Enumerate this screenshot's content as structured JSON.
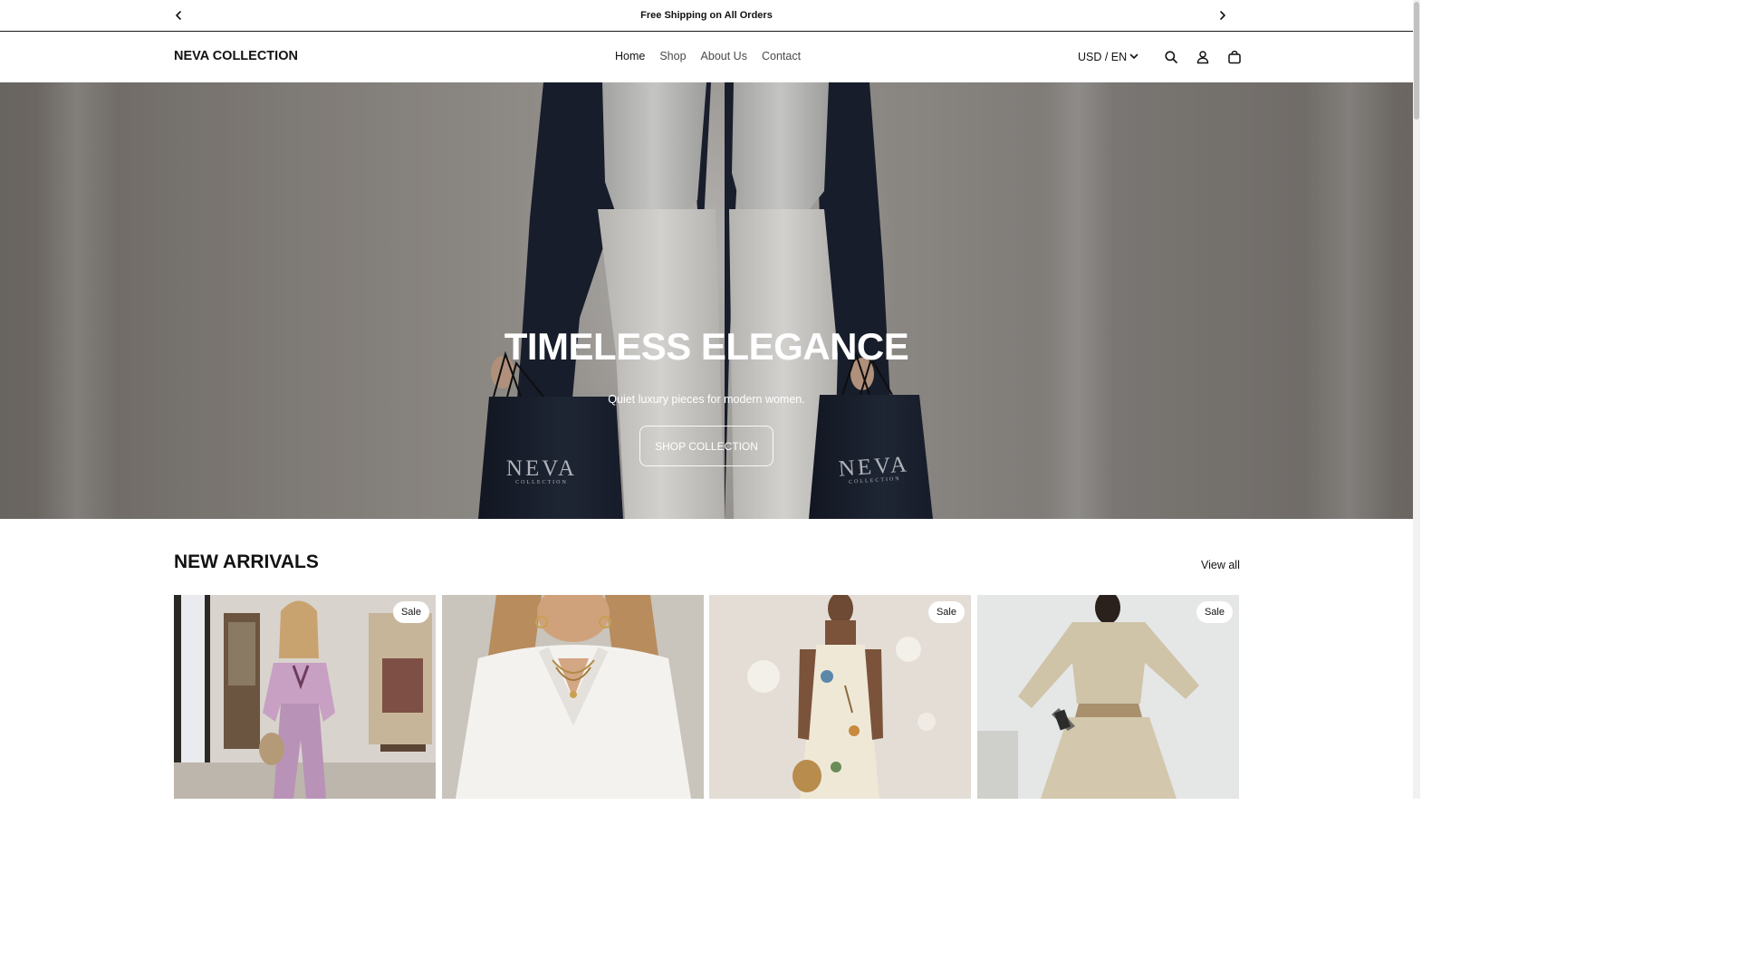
{
  "announcement": {
    "text": "Free Shipping on All Orders",
    "prev_icon": "chevron-left-icon",
    "next_icon": "chevron-right-icon"
  },
  "header": {
    "logo": "NEVA COLLECTION",
    "nav": [
      {
        "label": "Home",
        "active": true
      },
      {
        "label": "Shop",
        "active": false
      },
      {
        "label": "About Us",
        "active": false
      },
      {
        "label": "Contact",
        "active": false
      }
    ],
    "locale": "USD / EN",
    "icons": [
      "chevron-down-icon",
      "search-icon",
      "account-icon",
      "cart-icon"
    ]
  },
  "hero": {
    "title": "TIMELESS ELEGANCE",
    "subtitle": "Quiet luxury pieces for modern women.",
    "button": "SHOP COLLECTION",
    "bag_brand": "NEVA",
    "bag_sub": "COLLECTION"
  },
  "new_arrivals": {
    "title": "NEW ARRIVALS",
    "view_all": "View all",
    "products": [
      {
        "badge": "Sale"
      },
      {
        "badge": ""
      },
      {
        "badge": "Sale"
      },
      {
        "badge": "Sale"
      }
    ]
  },
  "colors": {
    "text": "#121212",
    "hero_navy": "#1c2230",
    "badge_bg": "#ffffff"
  }
}
